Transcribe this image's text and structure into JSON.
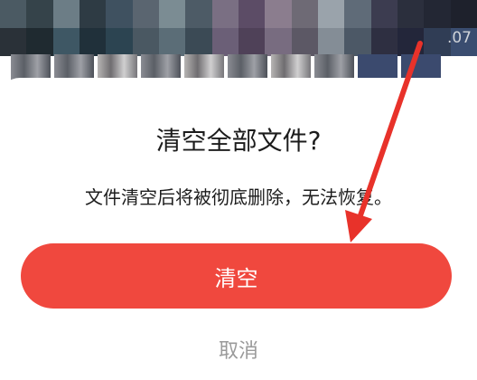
{
  "background": {
    "corner_text": ".07"
  },
  "dialog": {
    "title": "清空全部文件?",
    "message": "文件清空后将被彻底删除，无法恢复。",
    "confirm_label": "清空",
    "cancel_label": "取消"
  },
  "colors": {
    "confirm_button": "#f0483e",
    "annotation_arrow": "#e8322a",
    "cancel_text": "#9a9a9a"
  }
}
